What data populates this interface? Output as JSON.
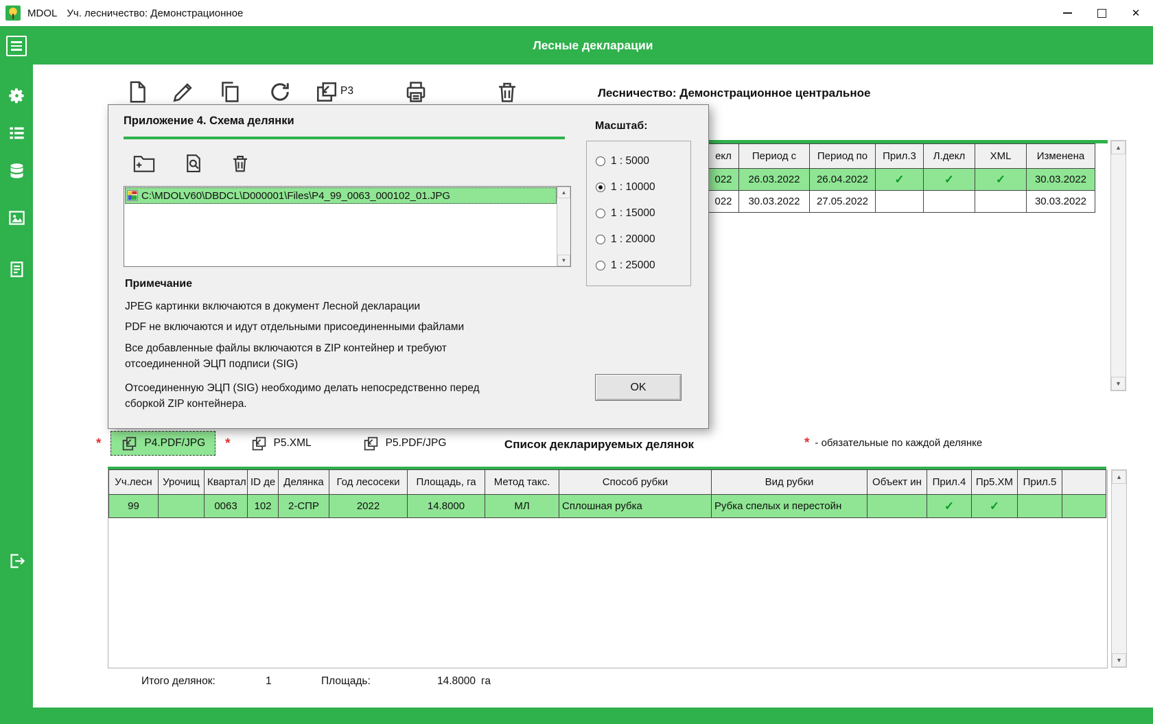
{
  "icons": {
    "scroll_up": "▲",
    "scroll_down": "▼",
    "close": "✕"
  },
  "colors": {
    "accent_green": "#2fb14c",
    "row_highlight": "#8fe593",
    "required_red": "#e03232"
  },
  "titlebar": {
    "app_name": "MDOL",
    "title": "Уч. лесничество: Демонстрационное"
  },
  "header": {
    "title": "Лесные декларации"
  },
  "toolbar": {
    "p3_label": "P3"
  },
  "content": {
    "forestry_label": "Лесничество: Демонстрационное центральное"
  },
  "dialog": {
    "title": "Приложение 4. Схема делянки",
    "file_path": "C:\\MDOLV60\\DBDCL\\D000001\\Files\\P4_99_0063_000102_01.JPG",
    "note_heading": "Примечание",
    "notes": [
      "JPEG картинки включаются в документ Лесной декларации",
      "PDF не включаются и идут отдельными присоединенными файлами",
      "Все добавленные файлы включаются в ZIP контейнер и требуют отсоединенной ЭЦП подписи (SIG)",
      "Отсоединенную ЭЦП (SIG) необходимо делать непосредственно перед сборкой ZIP контейнера."
    ],
    "scale": {
      "label": "Масштаб:",
      "options": [
        "1 : 5000",
        "1 : 10000",
        "1 : 15000",
        "1 : 20000",
        "1 : 25000"
      ],
      "selected": "1 : 10000"
    },
    "ok_label": "OK"
  },
  "declarations_table": {
    "columns": [
      "екл",
      "Период с",
      "Период по",
      "Прил.3",
      "Л.декл",
      "XML",
      "Изменена"
    ],
    "rows": [
      [
        "022",
        "26.03.2022",
        "26.04.2022",
        "✓",
        "✓",
        "✓",
        "30.03.2022"
      ],
      [
        "022",
        "30.03.2022",
        "27.05.2022",
        "",
        "",
        "",
        "30.03.2022"
      ]
    ]
  },
  "tabs": [
    {
      "label": "P4.PDF/JPG",
      "required": true,
      "active": true
    },
    {
      "label": "P5.XML",
      "required": true,
      "active": false
    },
    {
      "label": "P5.PDF/JPG",
      "required": false,
      "active": false
    }
  ],
  "plots_section": {
    "title": "Список декларируемых делянок",
    "required_marker": "*",
    "required_note": "- обязательные по каждой делянке"
  },
  "plots_table": {
    "columns": [
      "Уч.лесн",
      "Урочищ",
      "Квартал",
      "ID де",
      "Делянка",
      "Год лесосеки",
      "Площадь, га",
      "Метод такс.",
      "Способ рубки",
      "Вид рубки",
      "Объект ин",
      "Прил.4",
      "Пр5.ХМ",
      "Прил.5",
      ""
    ],
    "rows": [
      [
        "99",
        "",
        "0063",
        "102",
        "2-СПР",
        "2022",
        "14.8000",
        "МЛ",
        "Сплошная рубка",
        "Рубка спелых и перестойн",
        "",
        "✓",
        "✓",
        "",
        ""
      ]
    ]
  },
  "footer": {
    "total_label": "Итого делянок:",
    "total_value": "1",
    "area_label": "Площадь:",
    "area_value": "14.8000",
    "area_unit": "га"
  }
}
